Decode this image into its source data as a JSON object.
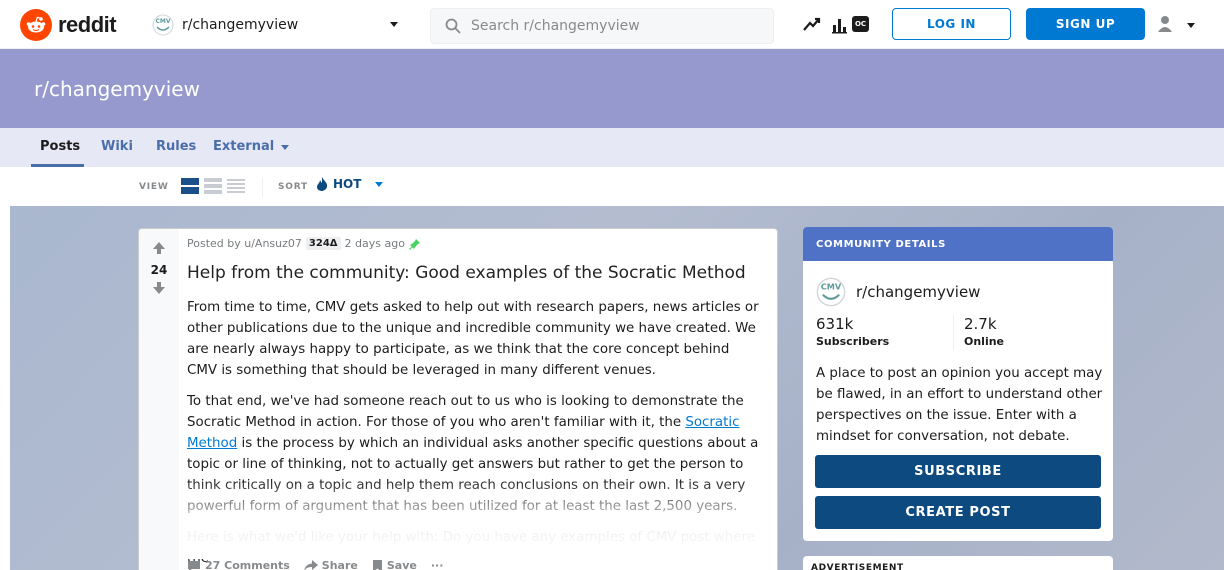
{
  "header": {
    "logo_text": "reddit",
    "subreddit_select": "r/changemyview",
    "search_placeholder": "Search r/changemyview",
    "login_label": "LOG IN",
    "signup_label": "SIGN UP",
    "icons": [
      "trending-icon",
      "stats-icon",
      "oc-icon",
      "user-icon"
    ],
    "oc_label": "OC"
  },
  "banner": {
    "title": "r/changemyview",
    "color": "#9599cd"
  },
  "nav": {
    "tabs": [
      {
        "label": "Posts",
        "active": true
      },
      {
        "label": "Wiki"
      },
      {
        "label": "Rules"
      },
      {
        "label": "External"
      }
    ]
  },
  "sortbar": {
    "view_label": "VIEW",
    "sort_label": "SORT",
    "sort_value": "HOT"
  },
  "post": {
    "votes": "24",
    "posted_by": "Posted by u/Ansuz07",
    "flair": "324Δ",
    "time": "2 days ago",
    "title": "Help from the community: Good examples of the Socratic Method",
    "p1": "From time to time, CMV gets asked to help out with research papers, news articles or other publications due to the unique and incredible community we have created. We are nearly always happy to participate, as we think that the core concept behind CMV is something that should be leveraged in many different venues.",
    "p2_before": "To that end, we've had someone reach out to us who is looking to demonstrate the Socratic Method in action. For those of you who aren't familiar with it, the ",
    "p2_link": "Socratic Method",
    "p2_after": " is the process by which an individual asks another specific questions about a topic or line of thinking, not to actually get answers but rather to get the person to think critically on a topic and help them reach conclusions on their own. It is a very powerful form of argument that has been utilized for at least the last 2,500 years.",
    "p3": "Here is what we'd like your help with: Do you have any examples of CMV post where the",
    "comments_label": "27 Comments",
    "share_label": "Share",
    "save_label": "Save",
    "more_label": "···"
  },
  "sidebar": {
    "header": "COMMUNITY DETAILS",
    "community_name": "r/changemyview",
    "subscribers_num": "631k",
    "subscribers_label": "Subscribers",
    "online_num": "2.7k",
    "online_label": "Online",
    "description": "A place to post an opinion you accept may be flawed, in an effort to understand other perspectives on the issue. Enter with a mindset for conversation, not debate.",
    "subscribe_label": "SUBSCRIBE",
    "create_post_label": "CREATE POST",
    "accent": "#4f72c7",
    "button_color": "#0d4a80"
  },
  "advertisement_label": "ADVERTISEMENT"
}
